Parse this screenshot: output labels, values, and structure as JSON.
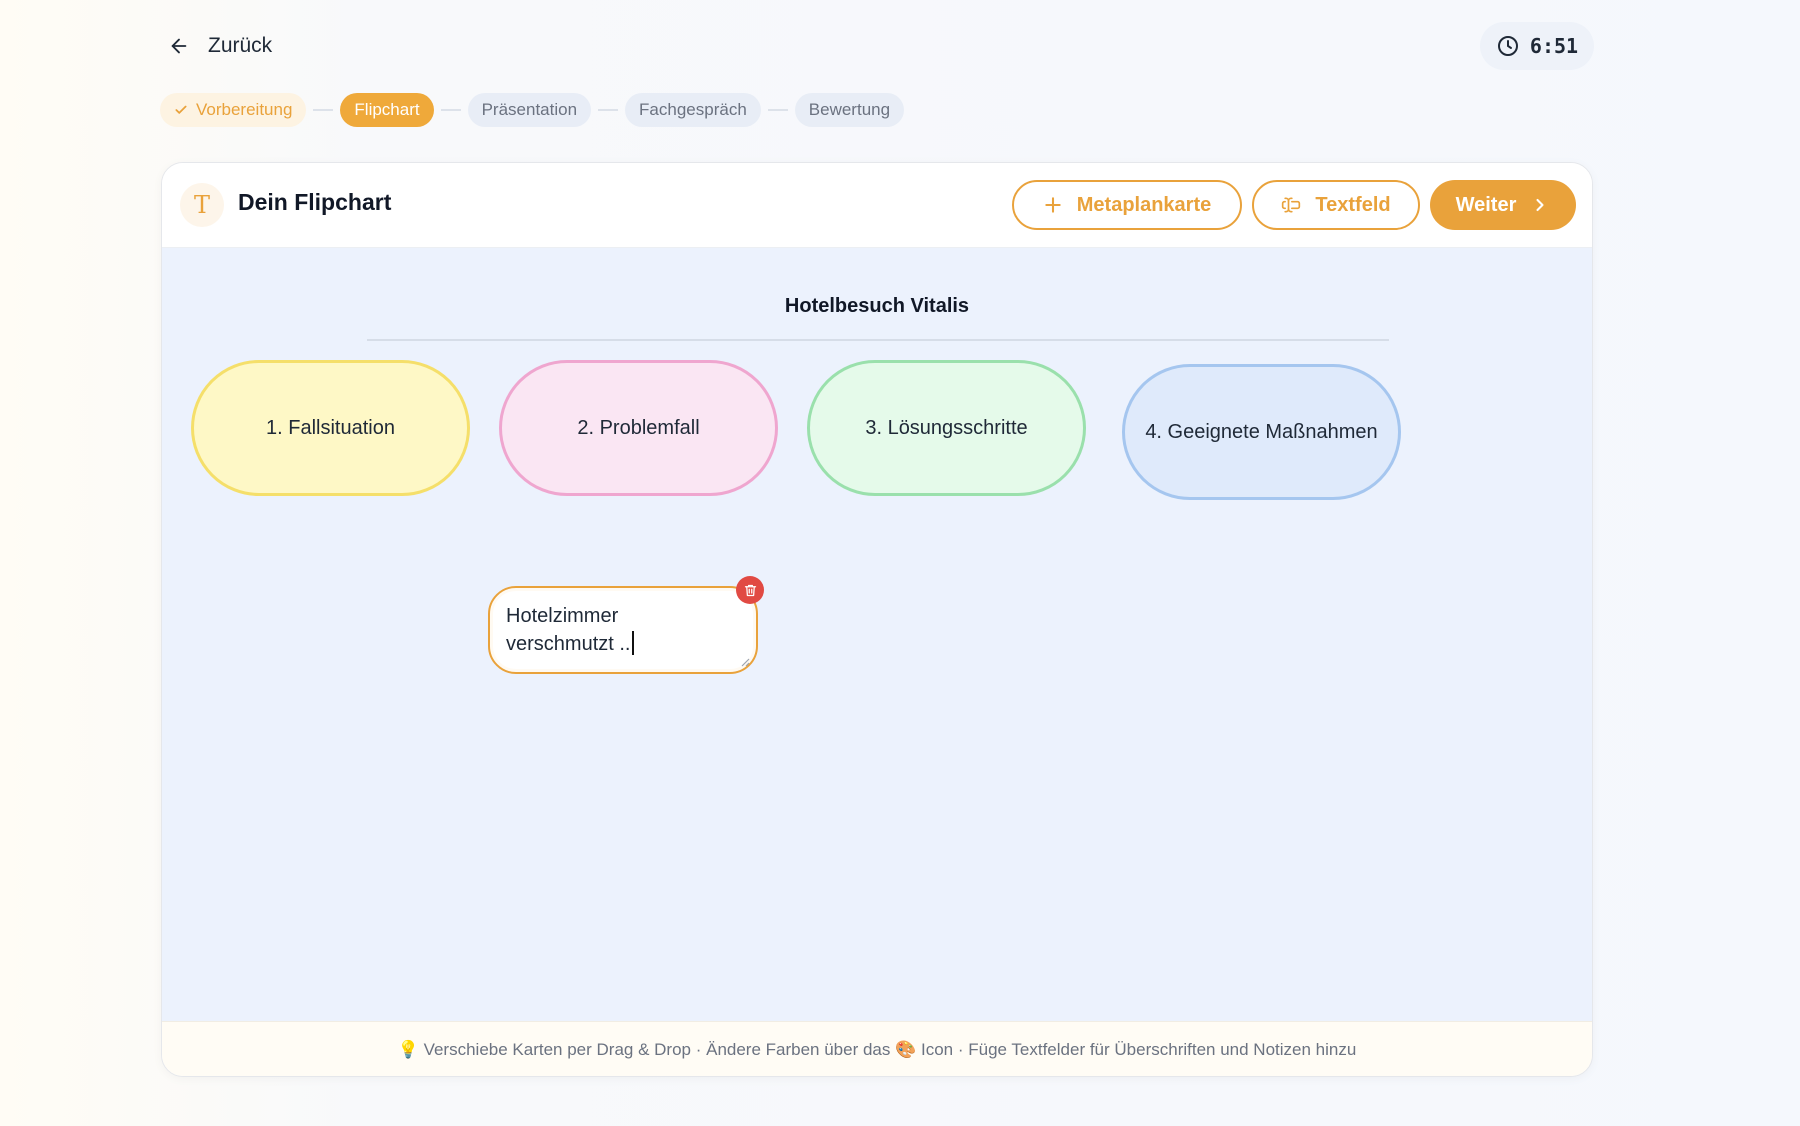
{
  "nav": {
    "back_label": "Zurück",
    "timer": "6:51"
  },
  "stepper": {
    "steps": [
      {
        "label": "Vorbereitung",
        "state": "done"
      },
      {
        "label": "Flipchart",
        "state": "active"
      },
      {
        "label": "Präsentation",
        "state": "pending"
      },
      {
        "label": "Fachgespräch",
        "state": "pending"
      },
      {
        "label": "Bewertung",
        "state": "pending"
      }
    ]
  },
  "header": {
    "icon": "text-T-icon",
    "title": "Dein Flipchart",
    "buttons": {
      "metaplan": "Metaplankarte",
      "textfield": "Textfeld",
      "next": "Weiter"
    }
  },
  "board": {
    "title": "Hotelbesuch Vitalis",
    "cards": [
      {
        "label": "1. Fallsituation",
        "color": "yellow"
      },
      {
        "label": "2. Problemfall",
        "color": "pink"
      },
      {
        "label": "3. Lösungsschritte",
        "color": "green"
      },
      {
        "label": "4. Geeignete Maßnahmen",
        "color": "blue"
      }
    ],
    "textfield": {
      "line1": "Hotelzimmer",
      "line2": "verschmutzt .."
    }
  },
  "footer": {
    "hint": "💡 Verschiebe Karten per Drag & Drop · Ändere Farben über das 🎨 Icon · Füge Textfelder für Überschriften und Notizen hinzu"
  },
  "colors": {
    "accent": "#e9a23b",
    "delete": "#e14a43",
    "board_bg": "#ecf2fd"
  }
}
